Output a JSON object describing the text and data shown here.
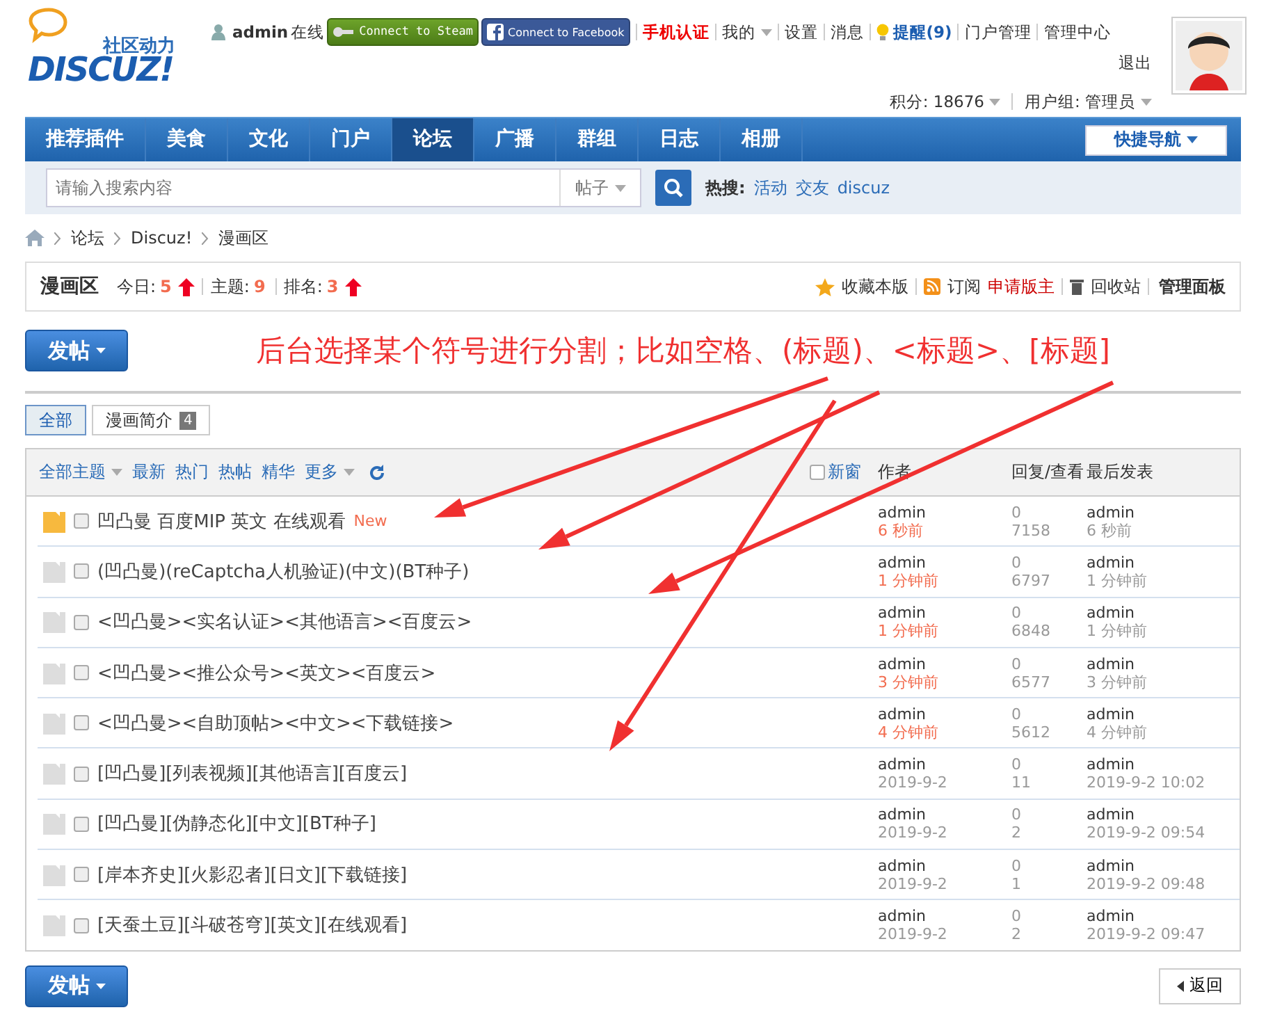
{
  "header": {
    "logo": {
      "tagline": "社区动力",
      "name": "DISCUZ!"
    },
    "user": "admin",
    "online": "在线",
    "connect_buttons": [
      {
        "kind": "steam",
        "label": "Connect to Steam"
      },
      {
        "kind": "facebook",
        "label": "Connect to Facebook"
      }
    ],
    "links": [
      {
        "kind": "alert",
        "label": "手机认证"
      },
      {
        "kind": "dropdown",
        "label": "我的"
      },
      {
        "kind": "plain",
        "label": "设置"
      },
      {
        "kind": "plain",
        "label": "消息"
      },
      {
        "kind": "notify",
        "label": "提醒(9)"
      },
      {
        "kind": "plain",
        "label": "门户管理"
      },
      {
        "kind": "plain",
        "label": "管理中心"
      }
    ],
    "logout": "退出",
    "credits": "积分: 18676",
    "usergroup": "用户组: 管理员"
  },
  "nav": {
    "items": [
      {
        "label": "推荐插件",
        "selected": false
      },
      {
        "label": "美食",
        "selected": false
      },
      {
        "label": "文化",
        "selected": false
      },
      {
        "label": "门户",
        "selected": false
      },
      {
        "label": "论坛",
        "selected": true
      },
      {
        "label": "广播",
        "selected": false
      },
      {
        "label": "群组",
        "selected": false
      },
      {
        "label": "日志",
        "selected": false
      },
      {
        "label": "相册",
        "selected": false
      }
    ],
    "quick_nav": "快捷导航"
  },
  "search": {
    "placeholder": "请输入搜索内容",
    "type": "帖子",
    "hot_label": "热搜:",
    "hot": [
      "活动",
      "交友",
      "discuz"
    ]
  },
  "breadcrumb": [
    "论坛",
    "Discuz!",
    "漫画区"
  ],
  "forum": {
    "name": "漫画区",
    "stats": [
      {
        "label": "今日:",
        "value": "5",
        "rising": true
      },
      {
        "label": "主题:",
        "value": "9",
        "rising": false
      },
      {
        "label": "排名:",
        "value": "3",
        "rising": true
      }
    ],
    "actions": [
      {
        "kind": "star",
        "label": "收藏本版"
      },
      {
        "kind": "rss",
        "label": "订阅"
      },
      {
        "kind": "apply",
        "label": "申请版主"
      },
      {
        "kind": "trash",
        "label": "回收站"
      },
      {
        "kind": "bold",
        "label": "管理面板"
      }
    ]
  },
  "post_button": "发帖",
  "annotation": "后台选择某个符号进行分割；比如空格、(标题)、<标题>、[标题]",
  "tabs": [
    {
      "label": "全部",
      "selected": true
    },
    {
      "label": "漫画简介",
      "count": "4",
      "selected": false
    }
  ],
  "thread_list": {
    "filters": [
      {
        "label": "全部主题",
        "dropdown": true
      },
      {
        "label": "最新",
        "dropdown": false
      },
      {
        "label": "热门",
        "dropdown": false
      },
      {
        "label": "热帖",
        "dropdown": false
      },
      {
        "label": "精华",
        "dropdown": false
      },
      {
        "label": "更多",
        "dropdown": true
      }
    ],
    "new_window": {
      "label": "新窗",
      "checked": false
    },
    "columns": [
      "作者",
      "回复/查看",
      "最后发表"
    ],
    "threads": [
      {
        "unread": true,
        "checked": false,
        "title": "凹凸曼 百度MIP 英文 在线观看",
        "badge": "New",
        "author": "admin",
        "date": "6 秒前",
        "recent": true,
        "replies": "0",
        "views": "7158",
        "last_author": "admin",
        "last_date": "6 秒前"
      },
      {
        "unread": false,
        "checked": false,
        "title": "(凹凸曼)(reCaptcha人机验证)(中文)(BT种子)",
        "author": "admin",
        "date": "1 分钟前",
        "recent": true,
        "replies": "0",
        "views": "6797",
        "last_author": "admin",
        "last_date": "1 分钟前"
      },
      {
        "unread": false,
        "checked": false,
        "title": "<凹凸曼><实名认证><其他语言><百度云>",
        "author": "admin",
        "date": "1 分钟前",
        "recent": true,
        "replies": "0",
        "views": "6848",
        "last_author": "admin",
        "last_date": "1 分钟前"
      },
      {
        "unread": false,
        "checked": false,
        "title": "<凹凸曼><推公众号><英文><百度云>",
        "author": "admin",
        "date": "3 分钟前",
        "recent": true,
        "replies": "0",
        "views": "6577",
        "last_author": "admin",
        "last_date": "3 分钟前"
      },
      {
        "unread": false,
        "checked": false,
        "title": "<凹凸曼><自助顶帖><中文><下载链接>",
        "author": "admin",
        "date": "4 分钟前",
        "recent": true,
        "replies": "0",
        "views": "5612",
        "last_author": "admin",
        "last_date": "4 分钟前"
      },
      {
        "unread": false,
        "checked": false,
        "title": "[凹凸曼][列表视频][其他语言][百度云]",
        "author": "admin",
        "date": "2019-9-2",
        "recent": false,
        "replies": "0",
        "views": "11",
        "last_author": "admin",
        "last_date": "2019-9-2 10:02"
      },
      {
        "unread": false,
        "checked": false,
        "title": "[凹凸曼][伪静态化][中文][BT种子]",
        "author": "admin",
        "date": "2019-9-2",
        "recent": false,
        "replies": "0",
        "views": "2",
        "last_author": "admin",
        "last_date": "2019-9-2 09:54"
      },
      {
        "unread": false,
        "checked": false,
        "title": "[岸本齐史][火影忍者][日文][下载链接]",
        "author": "admin",
        "date": "2019-9-2",
        "recent": false,
        "replies": "0",
        "views": "1",
        "last_author": "admin",
        "last_date": "2019-9-2 09:48"
      },
      {
        "unread": false,
        "checked": false,
        "title": "[天蚕土豆][斗破苍穹][英文][在线观看]",
        "author": "admin",
        "date": "2019-9-2",
        "recent": false,
        "replies": "0",
        "views": "2",
        "last_author": "admin",
        "last_date": "2019-9-2 09:47"
      }
    ]
  },
  "footer_post_button": "发帖",
  "back_button": "返回"
}
